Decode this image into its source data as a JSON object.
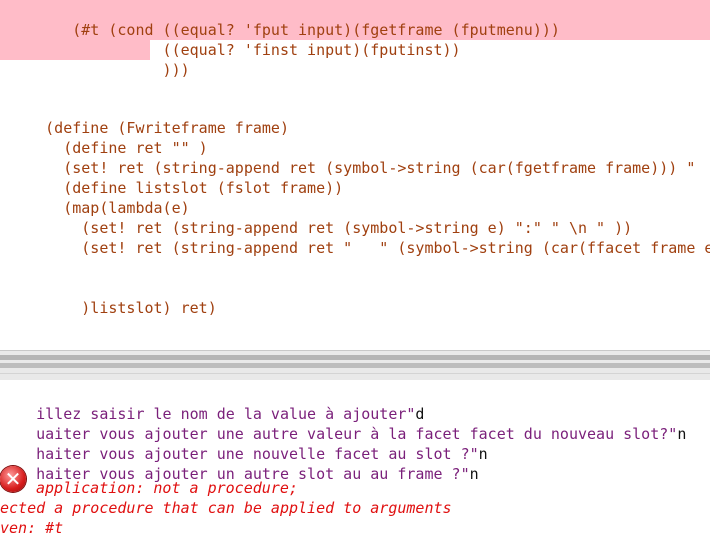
{
  "editor": {
    "lines": [
      "    (#t (cond ((equal? 'fput input)(fgetframe (fputmenu)))",
      "              ((equal? 'finst input)(fputinst))",
      "              )))",
      "",
      "",
      " (define (Fwriteframe frame)",
      "   (define ret \"\" )",
      "   (set! ret (string-append ret (symbol->string (car(fgetframe frame))) \"",
      "   (define listslot (fslot frame))",
      "   (map(lambda(e)",
      "     (set! ret (string-append ret (symbol->string e) \":\" \" \\n \" ))",
      "     (set! ret (string-append ret \"   \" (symbol->string (car(ffacet frame e",
      "",
      "",
      "     )listslot) ret)"
    ]
  },
  "repl": {
    "lines": [
      {
        "prompt": "illez saisir le nom de la value à ajouter\"",
        "answer": "d"
      },
      {
        "prompt": "uaiter vous ajouter une autre valeur à la facet facet du nouveau slot?\"",
        "answer": "n"
      },
      {
        "prompt": "haiter vous ajouter une nouvelle facet au slot ?\"",
        "answer": "n"
      },
      {
        "prompt": "haiter vous ajouter un autre slot au au frame ?\"",
        "answer": "n"
      }
    ],
    "error": {
      "icon": "error-icon",
      "line1": "application: not a procedure;",
      "line2": "ected a procedure that can be applied to arguments",
      "line3": "ven: #t"
    }
  },
  "colors": {
    "highlight": "#ffbcc8",
    "prompt_text": "#7a1f7a",
    "error_text": "#e01010"
  }
}
